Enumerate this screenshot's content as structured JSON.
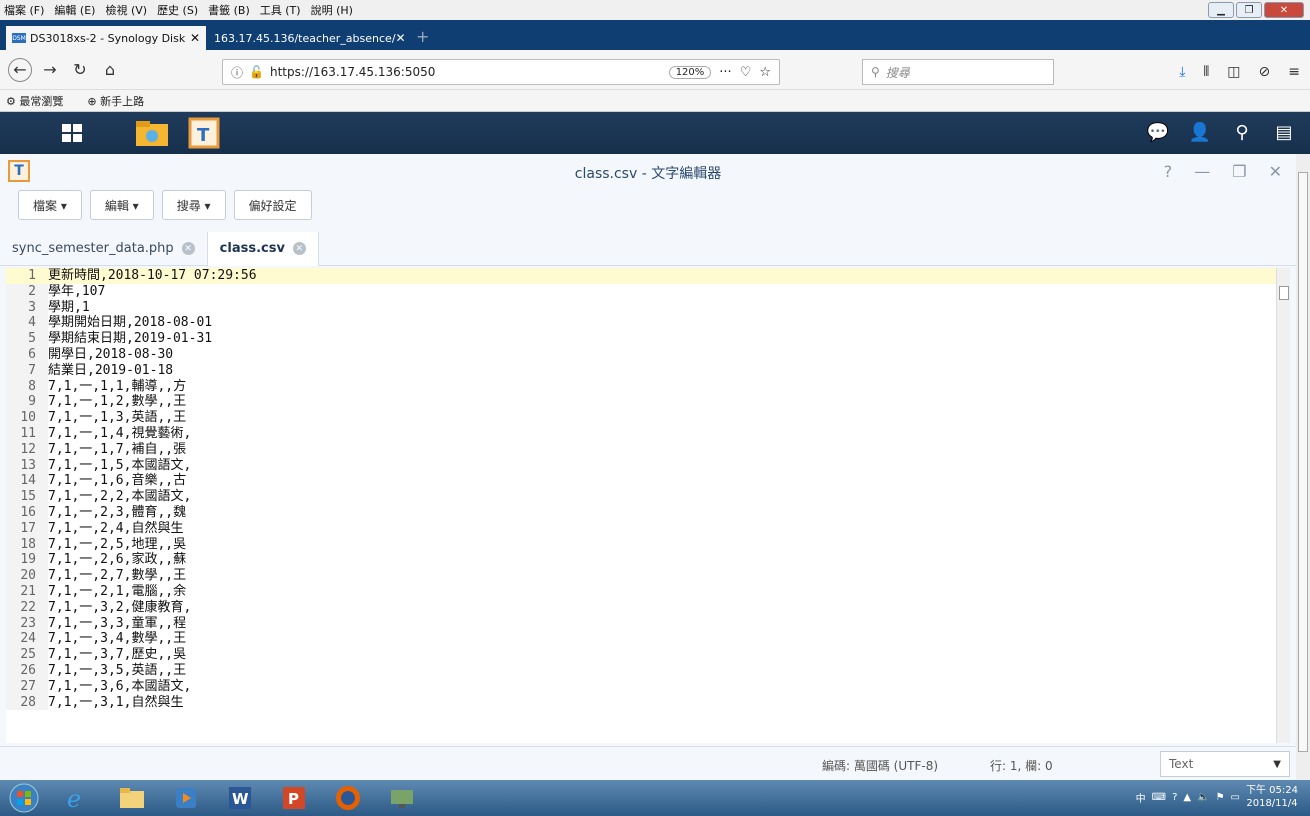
{
  "menubar": {
    "items": [
      "檔案 (F)",
      "編輯 (E)",
      "檢視 (V)",
      "歷史 (S)",
      "書籤 (B)",
      "工具 (T)",
      "說明 (H)"
    ]
  },
  "browser": {
    "tabs": [
      {
        "label": "DS3018xs-2 - Synology Disk"
      },
      {
        "label": "163.17.45.136/teacher_absence/"
      }
    ],
    "url": "https://163.17.45.136:5050",
    "zoom": "120%",
    "search_placeholder": "搜尋",
    "bookmarks": [
      "最常瀏覽",
      "新手上路"
    ]
  },
  "editor": {
    "title": "class.csv - 文字編輯器",
    "toolbar": {
      "file": "檔案 ▾",
      "edit": "編輯 ▾",
      "search": "搜尋 ▾",
      "prefs": "偏好設定"
    },
    "file_tabs": [
      {
        "label": "sync_semester_data.php"
      },
      {
        "label": "class.csv"
      }
    ],
    "lines": [
      {
        "n": "1",
        "t": "更新時間,2018-10-17 07:29:56"
      },
      {
        "n": "2",
        "t": "學年,107"
      },
      {
        "n": "3",
        "t": "學期,1"
      },
      {
        "n": "4",
        "t": "學期開始日期,2018-08-01"
      },
      {
        "n": "5",
        "t": "學期結束日期,2019-01-31"
      },
      {
        "n": "6",
        "t": "開學日,2018-08-30"
      },
      {
        "n": "7",
        "t": "結業日,2019-01-18"
      },
      {
        "n": "8",
        "t": "7,1,一,1,1,輔導,,方"
      },
      {
        "n": "9",
        "t": "7,1,一,1,2,數學,,王"
      },
      {
        "n": "10",
        "t": "7,1,一,1,3,英語,,王"
      },
      {
        "n": "11",
        "t": "7,1,一,1,4,視覺藝術,"
      },
      {
        "n": "12",
        "t": "7,1,一,1,7,補自,,張"
      },
      {
        "n": "13",
        "t": "7,1,一,1,5,本國語文,"
      },
      {
        "n": "14",
        "t": "7,1,一,1,6,音樂,,古"
      },
      {
        "n": "15",
        "t": "7,1,一,2,2,本國語文,"
      },
      {
        "n": "16",
        "t": "7,1,一,2,3,體育,,魏"
      },
      {
        "n": "17",
        "t": "7,1,一,2,4,自然與生"
      },
      {
        "n": "18",
        "t": "7,1,一,2,5,地理,,吳"
      },
      {
        "n": "19",
        "t": "7,1,一,2,6,家政,,蘇"
      },
      {
        "n": "20",
        "t": "7,1,一,2,7,數學,,王"
      },
      {
        "n": "21",
        "t": "7,1,一,2,1,電腦,,余"
      },
      {
        "n": "22",
        "t": "7,1,一,3,2,健康教育,"
      },
      {
        "n": "23",
        "t": "7,1,一,3,3,童軍,,程"
      },
      {
        "n": "24",
        "t": "7,1,一,3,4,數學,,王"
      },
      {
        "n": "25",
        "t": "7,1,一,3,7,歷史,,吳"
      },
      {
        "n": "26",
        "t": "7,1,一,3,5,英語,,王"
      },
      {
        "n": "27",
        "t": "7,1,一,3,6,本國語文,"
      },
      {
        "n": "28",
        "t": "7,1,一,3,1,自然與生"
      }
    ],
    "status": {
      "encoding": "編碼: 萬國碼 (UTF-8)",
      "position": "行: 1, 欄: 0",
      "mode": "Text"
    }
  },
  "taskbar": {
    "time": "下午 05:24",
    "date": "2018/11/4"
  }
}
